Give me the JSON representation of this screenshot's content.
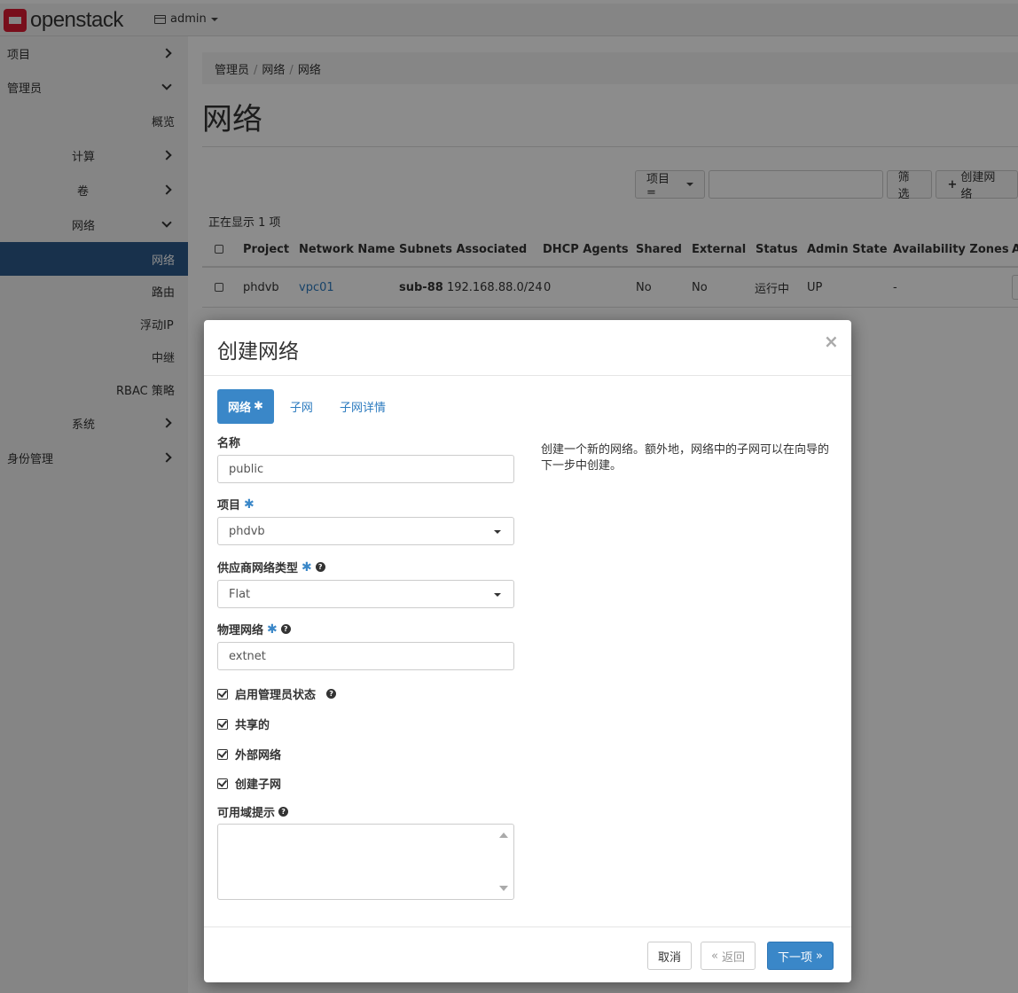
{
  "header": {
    "logo_text": "openstack",
    "project_menu": "admin"
  },
  "sidebar": {
    "items": [
      {
        "label": "项目"
      },
      {
        "label": "管理员"
      },
      {
        "label": "概览"
      },
      {
        "label": "计算"
      },
      {
        "label": "卷"
      },
      {
        "label": "网络"
      },
      {
        "label": "网络"
      },
      {
        "label": "路由"
      },
      {
        "label": "浮动IP"
      },
      {
        "label": "中继"
      },
      {
        "label": "RBAC 策略"
      },
      {
        "label": "系统"
      },
      {
        "label": "身份管理"
      }
    ]
  },
  "main": {
    "breadcrumb": [
      "管理员",
      "网络",
      "网络"
    ],
    "title": "网络",
    "filter": {
      "field_label": "项目 =",
      "filter_button": "筛选",
      "create_button": "创建网络"
    },
    "count_text": "正在显示 1 项",
    "table": {
      "columns": [
        "Project",
        "Network Name",
        "Subnets Associated",
        "DHCP Agents",
        "Shared",
        "External",
        "Status",
        "Admin State",
        "Availability Zones",
        "A"
      ],
      "rows": [
        {
          "project": "phdvb",
          "network_name": "vpc01",
          "subnet_name": "sub-88",
          "subnet_cidr": "192.168.88.0/24",
          "dhcp_agents": "0",
          "shared": "No",
          "external": "No",
          "status": "运行中",
          "admin_state": "UP",
          "availability_zones": "-"
        }
      ]
    }
  },
  "modal": {
    "title": "创建网络",
    "close_symbol": "×",
    "tabs": [
      {
        "label": "网络",
        "required_mark": "✱",
        "active": true
      },
      {
        "label": "子网"
      },
      {
        "label": "子网详情"
      }
    ],
    "fields": {
      "name_label": "名称",
      "name_value": "public",
      "project_label": "项目",
      "project_value": "phdvb",
      "provider_type_label": "供应商网络类型",
      "provider_type_value": "Flat",
      "physical_network_label": "物理网络",
      "physical_network_value": "extnet",
      "admin_state_label": "启用管理员状态",
      "shared_label": "共享的",
      "external_label": "外部网络",
      "create_subnet_label": "创建子网",
      "az_hints_label": "可用域提示"
    },
    "checkboxes": {
      "admin_state": true,
      "shared": true,
      "external": true,
      "create_subnet": true
    },
    "help_text": "创建一个新的网络。额外地，网络中的子网可以在向导的下一步中创建。",
    "footer": {
      "cancel": "取消",
      "back": "返回",
      "back_symbol": "«",
      "next": "下一项",
      "next_symbol": "»"
    },
    "required_star": "✱",
    "help_symbol": "?"
  },
  "colors": {
    "brand": "#da1a32",
    "accent": "#3a87c8",
    "sidebar_active": "#2c5a8a",
    "link": "#2c7bbf"
  }
}
